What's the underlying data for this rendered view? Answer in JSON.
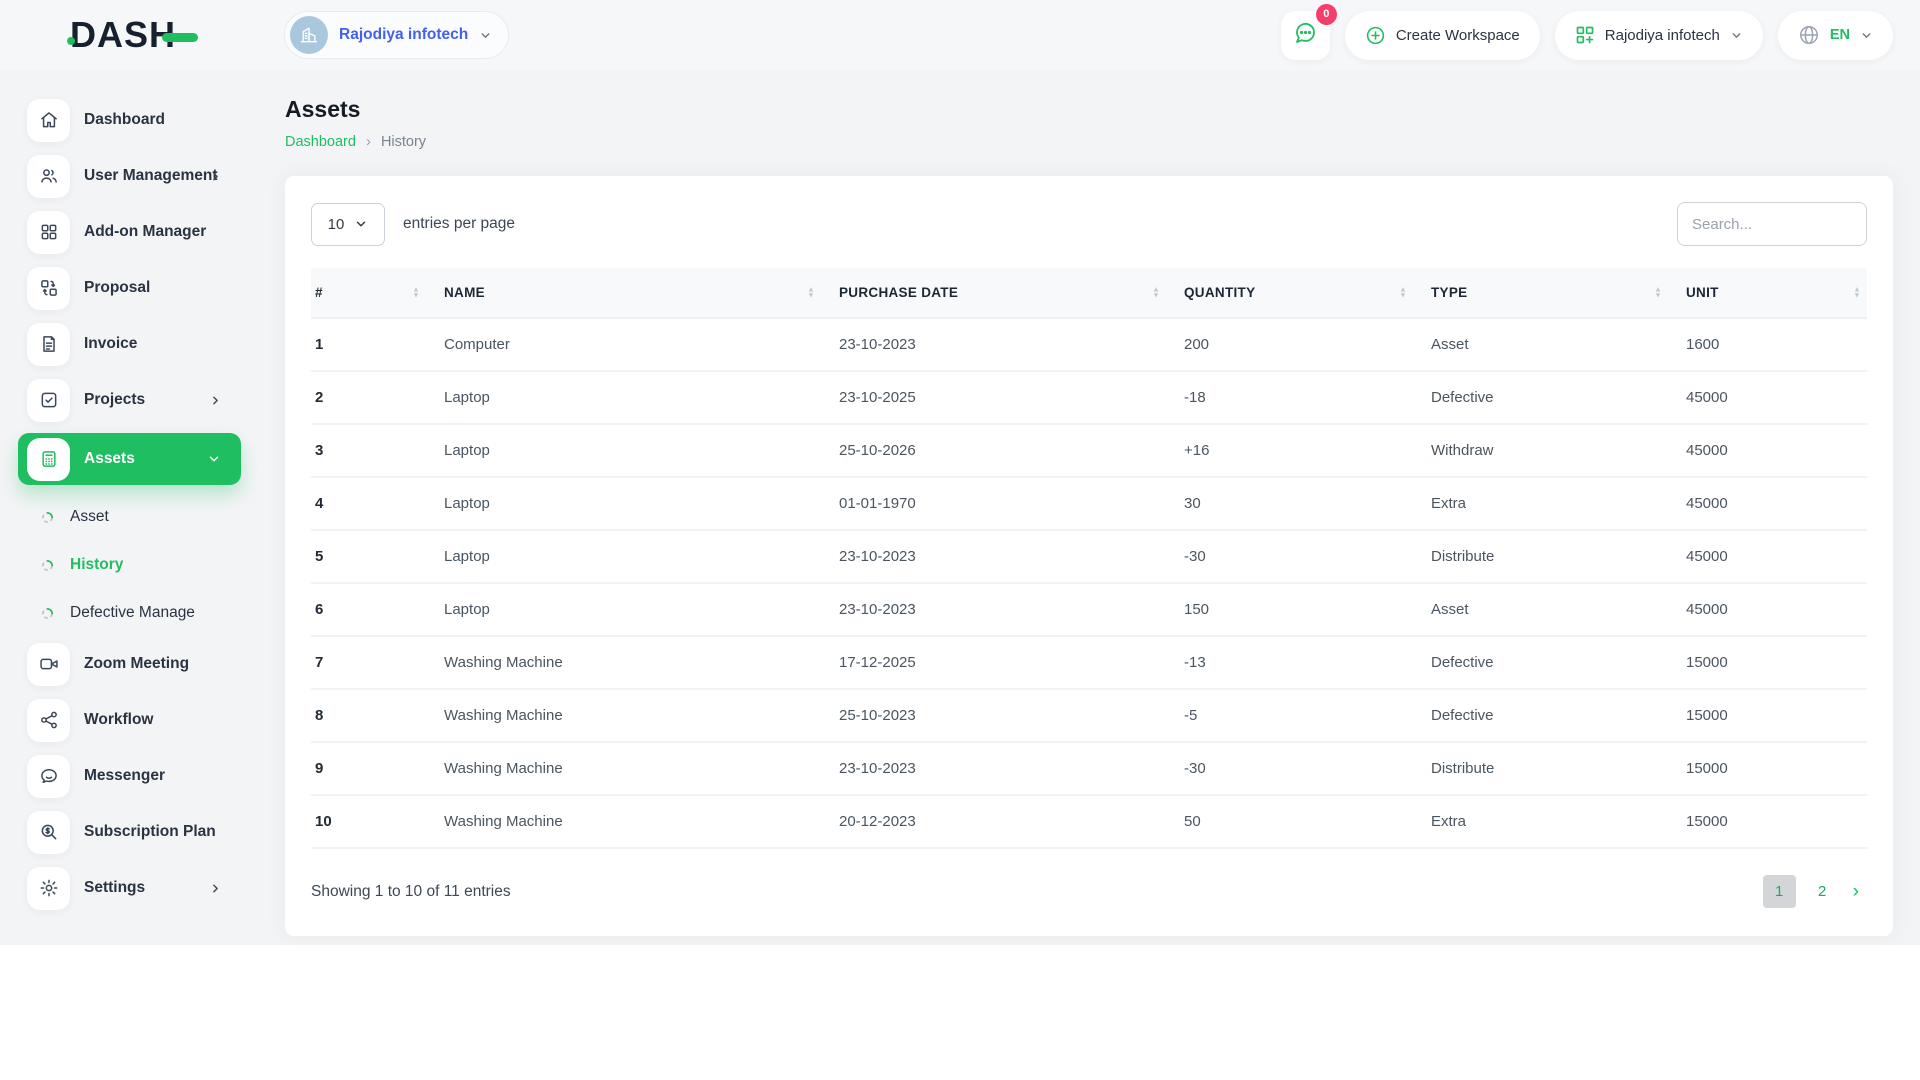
{
  "colors": {
    "accent": "#1fbe61",
    "badge": "#f43f6d",
    "workspace_text": "#4361ee"
  },
  "topbar": {
    "logo_text": "DASH",
    "workspace_switcher": {
      "label": "Rajodiya infotech"
    },
    "notification": {
      "badge_count": "0"
    },
    "create_workspace_label": "Create Workspace",
    "company_menu_label": "Rajodiya infotech",
    "language": "EN"
  },
  "sidebar": {
    "items": [
      {
        "label": "Dashboard",
        "icon": "home",
        "chevron": null,
        "active": false
      },
      {
        "label": "User Management",
        "icon": "users",
        "chevron": "right",
        "active": false
      },
      {
        "label": "Add-on Manager",
        "icon": "grid",
        "chevron": null,
        "active": false
      },
      {
        "label": "Proposal",
        "icon": "proposal",
        "chevron": null,
        "active": false
      },
      {
        "label": "Invoice",
        "icon": "invoice",
        "chevron": null,
        "active": false
      },
      {
        "label": "Projects",
        "icon": "projects",
        "chevron": "right",
        "active": false
      },
      {
        "label": "Assets",
        "icon": "assets",
        "chevron": "down",
        "active": true,
        "children": [
          {
            "label": "Asset",
            "active": false
          },
          {
            "label": "History",
            "active": true
          },
          {
            "label": "Defective Manage",
            "active": false
          }
        ]
      },
      {
        "label": "Zoom Meeting",
        "icon": "video",
        "chevron": null,
        "active": false
      },
      {
        "label": "Workflow",
        "icon": "workflow",
        "chevron": null,
        "active": false
      },
      {
        "label": "Messenger",
        "icon": "messenger",
        "chevron": null,
        "active": false
      },
      {
        "label": "Subscription Plan",
        "icon": "subscription",
        "chevron": null,
        "active": false
      },
      {
        "label": "Settings",
        "icon": "settings",
        "chevron": "right",
        "active": false
      }
    ]
  },
  "page": {
    "title": "Assets",
    "breadcrumb": {
      "home": "Dashboard",
      "separator": "›",
      "current": "History"
    }
  },
  "table_controls": {
    "per_page": "10",
    "entries_label": "entries per page",
    "search_placeholder": "Search..."
  },
  "table": {
    "columns": [
      "#",
      "NAME",
      "PURCHASE DATE",
      "QUANTITY",
      "TYPE",
      "UNIT"
    ],
    "rows": [
      [
        "1",
        "Computer",
        "23-10-2023",
        "200",
        "Asset",
        "1600"
      ],
      [
        "2",
        "Laptop",
        "23-10-2025",
        "-18",
        "Defective",
        "45000"
      ],
      [
        "3",
        "Laptop",
        "25-10-2026",
        "+16",
        "Withdraw",
        "45000"
      ],
      [
        "4",
        "Laptop",
        "01-01-1970",
        "30",
        "Extra",
        "45000"
      ],
      [
        "5",
        "Laptop",
        "23-10-2023",
        "-30",
        "Distribute",
        "45000"
      ],
      [
        "6",
        "Laptop",
        "23-10-2023",
        "150",
        "Asset",
        "45000"
      ],
      [
        "7",
        "Washing Machine",
        "17-12-2025",
        "-13",
        "Defective",
        "15000"
      ],
      [
        "8",
        "Washing Machine",
        "25-10-2023",
        "-5",
        "Defective",
        "15000"
      ],
      [
        "9",
        "Washing Machine",
        "23-10-2023",
        "-30",
        "Distribute",
        "15000"
      ],
      [
        "10",
        "Washing Machine",
        "20-12-2023",
        "50",
        "Extra",
        "15000"
      ]
    ]
  },
  "footer": {
    "showing_text": "Showing 1 to 10 of 11 entries",
    "pages": [
      {
        "label": "1",
        "active": true
      },
      {
        "label": "2",
        "active": false
      }
    ],
    "next_label": "›"
  }
}
